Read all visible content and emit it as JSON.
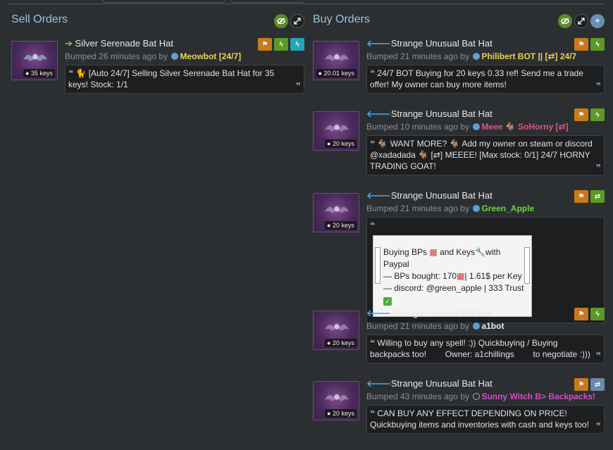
{
  "sell": {
    "title": "Sell Orders",
    "listings": [
      {
        "item_title": "Silver Serenade Bat Hat",
        "price": "35 keys",
        "bumped_prefix": "Bumped 26 minutes ago by",
        "user": "Meowbot [24/7]",
        "message": "[Auto 24/7] Selling Silver Serenade Bat Hat for 35 keys! Stock: 1/1"
      }
    ]
  },
  "buy": {
    "title": "Buy Orders",
    "listings": [
      {
        "item_title": "Strange Unusual Bat Hat",
        "price": "20.01 keys",
        "bumped_prefix": "Bumped 21 minutes ago by",
        "user": "Philibert BOT || [⇄] 24/7",
        "message": "24/7 BOT Buying for 20 keys 0.33 ref! Send me a trade offer! My owner can buy more items!"
      },
      {
        "item_title": "Strange Unusual Bat Hat",
        "price": "20 keys",
        "bumped_prefix": "Bumped 10 minutes ago by",
        "user": "Meee",
        "user_suffix": "SoHorny [⇄]",
        "message_a": "WANT MORE?",
        "message_b": "Add my owner on steam or discord @xadadada",
        "message_c": "[⇄] MEEEE! [Max stock: 0/1] 24/7 HORNY TRADING GOAT!"
      },
      {
        "item_title": "Strange Unusual Bat Hat",
        "price": "20 keys",
        "bumped_prefix": "Bumped 21 minutes ago by",
        "user": "Green_Apple",
        "table_line1": "Buying BPs",
        "table_line1b": "and Keys",
        "table_line1c": "with Paypal",
        "table_line2": "— BPs bought: 170",
        "table_line2b": "| 1.61$ per Key",
        "table_line3": "— discord: @green_apple | 333 Trust"
      },
      {
        "item_title": "Strange Unusual Bat Hat",
        "price": "20 keys",
        "bumped_prefix": "Bumped 21 minutes ago by",
        "user": "a1bot",
        "message": "Willing to buy any spell! :)) Quickbuying / Buying backpacks too!        Owner: a1chillings        to negotiate :)))"
      },
      {
        "item_title": "Strange Unusual Bat Hat",
        "price": "20 keys",
        "bumped_prefix": "Bumped 43 minutes ago by",
        "user": "Sunny Witch B> Backpacks!",
        "message": "CAN BUY ANY EFFECT DEPENDING ON PRICE! Quickbuying items and inventories with cash and keys too!"
      }
    ]
  },
  "colors": {
    "background": "#2c2f32",
    "title": "#9ec0d8",
    "flag_orange": "#c77a1c",
    "bump_green": "#5b9a26",
    "bump_teal": "#1ea8b8",
    "trade_slate": "#6a8aa8"
  },
  "icons": [
    "eye-slash-icon",
    "expand-icon",
    "plus-icon",
    "flag-icon",
    "lightning-icon",
    "swap-icon",
    "arrow-right-icon",
    "arrow-left-icon",
    "tag-icon",
    "quote-icon",
    "cat-icon",
    "goat-icon",
    "wrench-icon",
    "backpack-icon",
    "check-icon"
  ]
}
